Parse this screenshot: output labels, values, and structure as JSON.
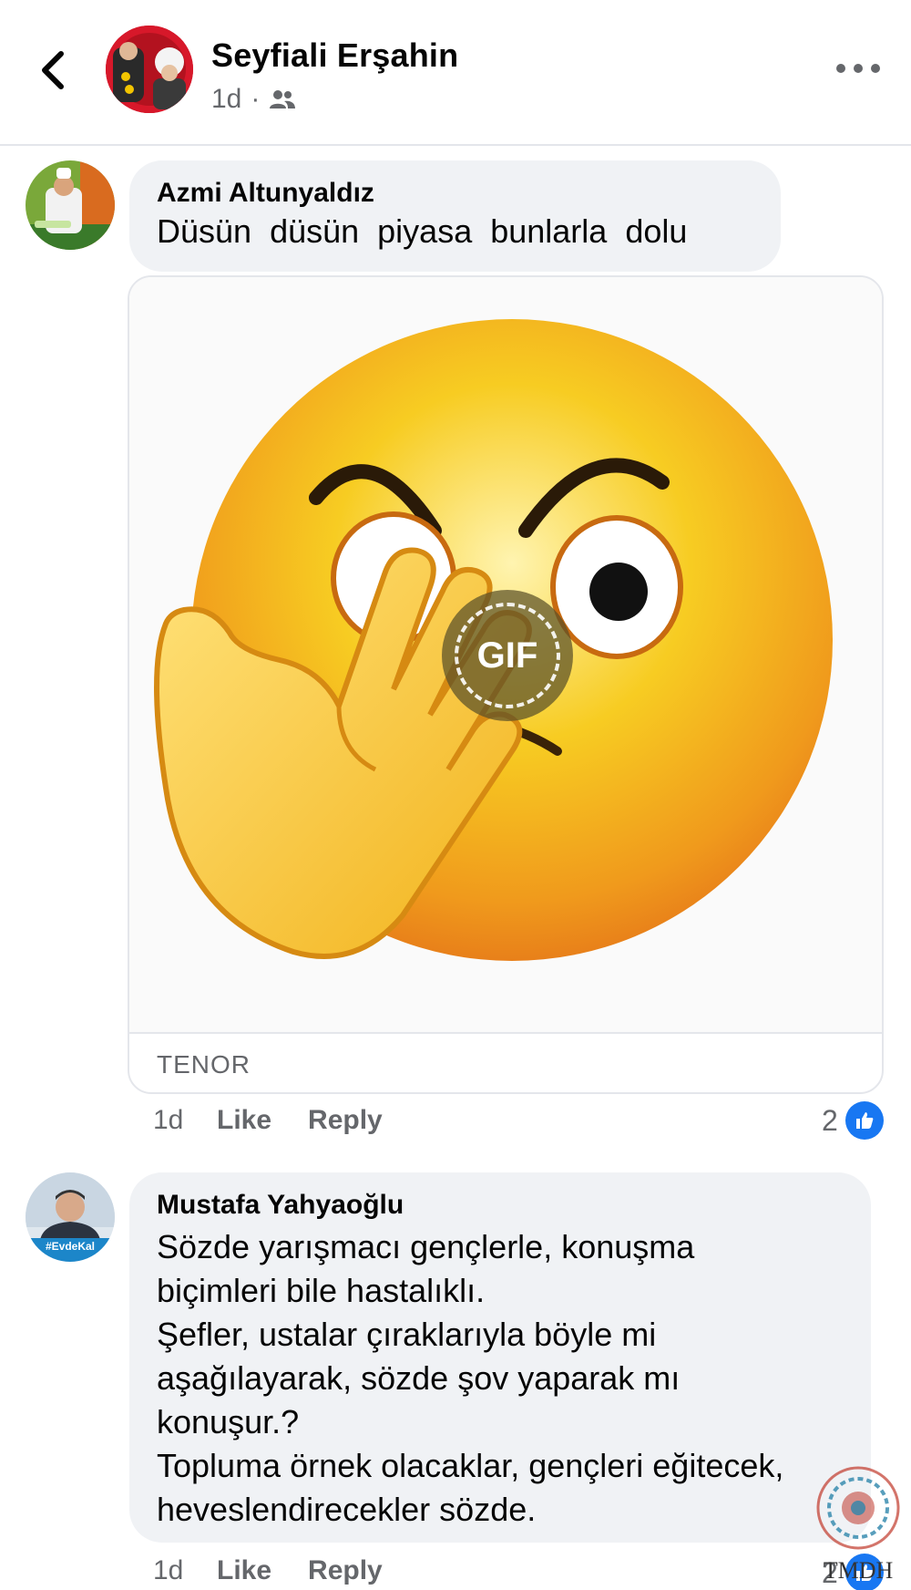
{
  "header": {
    "name": "Seyfiali Erşahin",
    "time": "1d",
    "separator": "·",
    "audience_icon": "friends-icon",
    "back_icon": "chevron-left-icon",
    "more_icon": "more-horizontal-icon"
  },
  "comments": [
    {
      "author": "Azmi Altunyaldız",
      "text": "Düsün  düsün  piyasa  bunlarla  dolu",
      "gif": {
        "badge": "GIF",
        "provider": "TENOR"
      },
      "time": "1d",
      "like_label": "Like",
      "reply_label": "Reply",
      "reaction_count": "2",
      "reaction_icon": "like-icon"
    },
    {
      "author": "Mustafa Yahyaoğlu",
      "lines": [
        "Sözde yarışmacı gençlerle, konuşma",
        "biçimleri bile hastalıklı.",
        "Şefler, ustalar çıraklarıyla böyle mi",
        "aşağılayarak, sözde şov yaparak mı",
        "konuşur.?",
        "Topluma örnek olacaklar, gençleri eğitecek,",
        "heveslendirecekler sözde."
      ],
      "avatar_caption": "#EvdeKal",
      "time": "1d",
      "like_label": "Like",
      "reply_label": "Reply",
      "reaction_count": "2",
      "reaction_icon": "like-icon"
    }
  ],
  "watermark": {
    "text": "TMDH"
  },
  "colors": {
    "brand_blue": "#1877f2",
    "bubble_bg": "#f0f2f5",
    "secondary_text": "#65676b",
    "emoji_yellow": "#f6c21c",
    "emoji_orange": "#ef8a1a"
  }
}
